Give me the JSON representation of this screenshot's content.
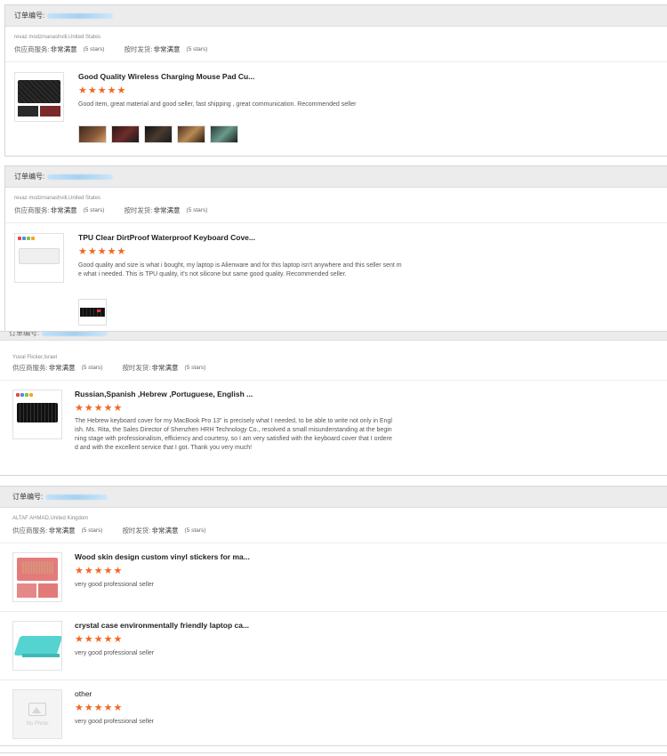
{
  "labels": {
    "order_prefix": "订单编号:",
    "supplier_service": "供应商服务:",
    "on_time_shipping": "按时发货:",
    "rating_value": "非常满意",
    "rating_stars": "(5 stars)"
  },
  "colors": {
    "star": "#f26722",
    "header_bg": "#ececec",
    "order_number_blur": "#a6d1f1"
  },
  "reviews": [
    {
      "buyer": "revaz modzmanashvili,United States",
      "items": [
        {
          "title": "Good Quality Wireless Charging Mouse Pad Cu...",
          "stars": 5,
          "comment": "Good item, great material and good seller, fast shipping , great communication. Recommended seller",
          "photo_count": 5
        }
      ]
    },
    {
      "buyer": "revaz modzmanashvili,United States",
      "items": [
        {
          "title": "TPU Clear DirtProof Waterproof Keyboard Cove...",
          "stars": 5,
          "comment": "Good quality and size is what i bought, my laptop is Alienware and for this laptop isn't anywhere and this seller sent me what i needed. This is TPU quality, it's not silicone but same good quality. Recommended seller.",
          "photo_count": 1
        }
      ]
    },
    {
      "buyer": "Yuval Flicker,Israel",
      "items": [
        {
          "title": "Russian,Spanish ,Hebrew ,Portuguese, English ...",
          "stars": 5,
          "comment": "The Hebrew keyboard cover for my MacBook Pro 13\" is precisely what I needed, to be able to write not only in English. Ms. Rita, the Sales Director of Shenzhen HRH Technology Co., resolved a small misunderstanding at the beginning stage with professionalism, efficiency and courtesy, so I am very satisfied with the keyboard cover that I ordered and with the excellent service that I got. Thank you very much!",
          "photo_count": 0
        }
      ]
    },
    {
      "buyer": "ALTAF AHMAD,United Kingdom",
      "items": [
        {
          "title": "Wood skin design custom vinyl stickers for ma...",
          "stars": 5,
          "comment": "very good professional seller",
          "photo_count": 0
        },
        {
          "title": "crystal case environmentally friendly laptop ca...",
          "stars": 5,
          "comment": "very good professional seller",
          "photo_count": 0
        },
        {
          "title": "other",
          "stars": 5,
          "comment": "very good professional seller",
          "photo_count": 0,
          "thumb_text": "No Photo"
        }
      ]
    }
  ]
}
